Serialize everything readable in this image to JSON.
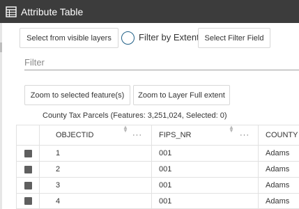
{
  "window": {
    "title": "Attribute Table",
    "icon": "table-icon"
  },
  "toolbar": {
    "select_visible_label": "Select from visible layers",
    "filter_extent_label": "Filter by Extent",
    "filter_extent_checked": false,
    "select_filter_field_label": "Select Filter Field"
  },
  "filter": {
    "placeholder": "Filter",
    "value": ""
  },
  "actions": {
    "zoom_selected_label": "Zoom to selected feature(s)",
    "zoom_full_label": "Zoom to Layer Full extent"
  },
  "layer_info": "County Tax Parcels (Features: 3,251,024, Selected: 0)",
  "table": {
    "columns": [
      {
        "label": "OBJECTID",
        "sortable": true,
        "menu": "···"
      },
      {
        "label": "FIPS_NR",
        "sortable": true,
        "menu": "···"
      },
      {
        "label": "COUNTY",
        "sortable": false,
        "menu": ""
      }
    ],
    "rows": [
      [
        "1",
        "001",
        "Adams"
      ],
      [
        "2",
        "001",
        "Adams"
      ],
      [
        "3",
        "001",
        "Adams"
      ],
      [
        "4",
        "001",
        "Adams"
      ]
    ]
  },
  "colors": {
    "title_bar": "#3c3c3c",
    "radio_border": "#1f5f86",
    "select_box": "#5f5f5f"
  }
}
